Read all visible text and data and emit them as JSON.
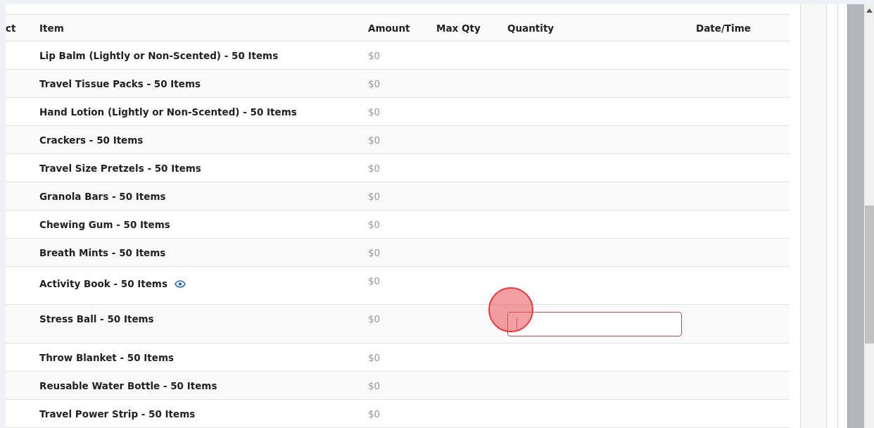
{
  "table": {
    "columns": [
      "ct",
      "Item",
      "Amount",
      "Max Qty",
      "Quantity",
      "Date/Time"
    ],
    "rows": [
      {
        "item": "Lip Balm (Lightly or Non-Scented) - 50 Items",
        "amount": "$0",
        "kind": "plain",
        "preview": false
      },
      {
        "item": "Travel Tissue Packs - 50 Items",
        "amount": "$0",
        "kind": "plain",
        "preview": false
      },
      {
        "item": "Hand Lotion (Lightly or Non-Scented) - 50 Items",
        "amount": "$0",
        "kind": "plain",
        "preview": false
      },
      {
        "item": "Crackers - 50 Items",
        "amount": "$0",
        "kind": "plain",
        "preview": false
      },
      {
        "item": "Travel Size Pretzels - 50 Items",
        "amount": "$0",
        "kind": "plain",
        "preview": false
      },
      {
        "item": "Granola Bars - 50 Items",
        "amount": "$0",
        "kind": "plain",
        "preview": false
      },
      {
        "item": "Chewing Gum - 50 Items",
        "amount": "$0",
        "kind": "plain",
        "preview": false
      },
      {
        "item": "Breath Mints - 50 Items",
        "amount": "$0",
        "kind": "plain",
        "preview": false
      },
      {
        "item": "Activity Book - 50 Items",
        "amount": "$0",
        "kind": "tall",
        "preview": true
      },
      {
        "item": "Stress Ball - 50 Items",
        "amount": "$0",
        "kind": "field",
        "preview": false,
        "focused": true
      },
      {
        "item": "Throw Blanket - 50 Items",
        "amount": "$0",
        "kind": "plain",
        "preview": false
      },
      {
        "item": "Reusable Water Bottle - 50 Items",
        "amount": "$0",
        "kind": "plain",
        "preview": false
      },
      {
        "item": "Travel Power Strip - 50 Items",
        "amount": "$0",
        "kind": "plain",
        "preview": false
      }
    ]
  }
}
